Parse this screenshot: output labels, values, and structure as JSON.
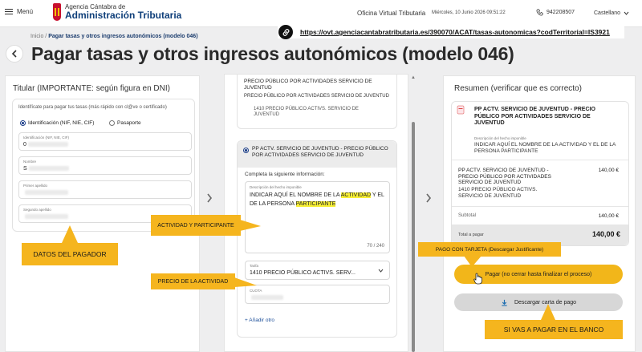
{
  "header": {
    "menu_label": "Menú",
    "logo_line1": "Agencia Cántabra de",
    "logo_line2": "Administración Tributaria",
    "portal": "Oficina Virtual Tributaria",
    "datetime": "Miércoles, 10 Junio 2026 09:51:22",
    "phone": "942208507",
    "language": "Castellano"
  },
  "url_bar": {
    "url": "https://ovt.agenciacantabratributaria.es/390070/ACAT/tasas-autonomicas?codTerritorial=IS3921"
  },
  "breadcrumb": {
    "home": "Inicio",
    "separator": "/",
    "current": "Pagar tasas y otros ingresos autonómicos (modelo 046)"
  },
  "page_title": "Pagar tasas y otros ingresos autonómicos (modelo 046)",
  "left": {
    "title": "Titular (IMPORTANTE: según figura en DNI)",
    "identify_text": "Identifícate para pagar tus tasas (más rápido con cl@ve o certificado)",
    "radio_id": "Identificación (NIF, NIE, CIF)",
    "radio_passport": "Pasaporte",
    "fields": [
      {
        "label": "Identificación (NIF, NIE, CIF)",
        "value": "0"
      },
      {
        "label": "Nombre",
        "value": "S"
      },
      {
        "label": "Primer apellido",
        "value": ""
      },
      {
        "label": "Segundo apellido",
        "value": ""
      }
    ],
    "callout": "DATOS DEL PAGADOR"
  },
  "middle": {
    "top_card": {
      "line1": "PRECIO PÚBLICO POR ACTIVIDADES SERVICIO DE JUVENTUD",
      "line2": "PRECIO PÚBLICO POR ACTIVIDADES SERVICIO DE JUVENTUD",
      "line3": "1410 PRECIO PÚBLICO ACTIVS. SERVICIO DE JUVENTUD"
    },
    "selected_card": {
      "title": "PP ACTV. SERVICIO DE JUVENTUD - PRECIO PÚBLICO POR ACTIVIDADES SERVICIO DE JUVENTUD",
      "complete_label": "Completa la siguiente información:",
      "textarea_label": "Descripción del hecho imponible",
      "textarea_before": "INDICAR AQUÍ EL NOMBRE DE LA ",
      "textarea_hl1": "ACTIVIDAD",
      "textarea_middle": " Y EL DE LA PERSONA ",
      "textarea_hl2": "PARTICIPANTE",
      "char_count": "70 / 240",
      "tarifa_label": "Tarifa",
      "tarifa_value": "1410 PRECIO PÚBLICO ACTIVS. SERV...",
      "cuota_label": "CUOTA",
      "add_other": "+ Añadir otro"
    },
    "callout_activity": "ACTIVIDAD Y PARTICIPANTE",
    "callout_price": "PRECIO DE LA ACTIVIDAD"
  },
  "right": {
    "title": "Resumen (verificar que es correcto)",
    "item_title": "PP ACTV. SERVICIO DE JUVENTUD - PRECIO PÚBLICO POR ACTIVIDADES SERVICIO DE JUVENTUD",
    "desc_label": "Descripción del hecho imponible",
    "desc_value": "INDICAR AQUÍ EL NOMBRE DE LA ACTIVIDAD Y EL DE LA PERSONA PARTICIPANTE",
    "line_item_title": "PP ACTV. SERVICIO DE JUVENTUD - PRECIO PÚBLICO POR ACTIVIDADES SERVICIO DE JUVENTUD",
    "line_item_sub": "1410 PRECIO PÚBLICO ACTIVS. SERVICIO DE JUVENTUD",
    "line_item_amount": "140,00 €",
    "subtotal_label": "Subtotal",
    "subtotal_value": "140,00 €",
    "total_label": "Total a pagar",
    "total_value": "140,00 €",
    "callout_card": "PAGO CON TARJETA (Descargar Justificante)",
    "pay_button": "Pagar (no cerrar hasta finalizar el proceso)",
    "download_button": "Descargar carta de pago",
    "callout_bank": "SI VAS A PAGAR EN EL BANCO"
  },
  "colors": {
    "accent": "#f5b51e",
    "brand": "#0f3f7a",
    "highlight": "#f7ef36"
  },
  "icons": [
    "menu-icon",
    "phone-icon",
    "chevron-down-icon",
    "link-icon",
    "back-arrow-icon",
    "chevron-right-icon",
    "download-icon",
    "hand-cursor-icon"
  ]
}
